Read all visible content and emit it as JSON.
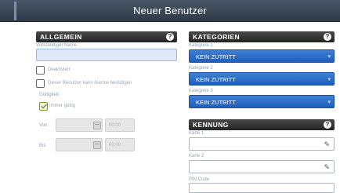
{
  "window": {
    "title": "Neuer Benutzer"
  },
  "allgemein": {
    "header": "Allgemein",
    "help": "?",
    "full_name_label": "Vollständiger Name",
    "full_name_value": "",
    "deactivated_label": "Deaktiviert",
    "deactivated_checked": false,
    "cannot_confirm_label": "Dieser Benutzer kann Alarme bestätigen",
    "cannot_confirm_checked": false,
    "validity_label": "Gültigkeit",
    "always_valid_label": "Immer gültig",
    "always_valid_checked": true,
    "from_label": "Von",
    "to_label": "Bis",
    "from_time": "00:00",
    "to_time": "00:00"
  },
  "kategorien": {
    "header": "Kategorien",
    "help": "?",
    "items": [
      {
        "label": "Kategorie 1",
        "value": "KEIN ZUTRITT"
      },
      {
        "label": "Kategorie 2",
        "value": "KEIN ZUTRITT"
      },
      {
        "label": "Kategorie 3",
        "value": "KEIN ZUTRITT"
      }
    ]
  },
  "kennung": {
    "header": "Kennung",
    "help": "?",
    "card1_label": "Karte 1",
    "card2_label": "Karte 2",
    "pin_label": "PIN Code"
  },
  "colors": {
    "titlebar": "#2f3a47",
    "select_blue": "#1d5fbe",
    "section_header": "#232323"
  }
}
